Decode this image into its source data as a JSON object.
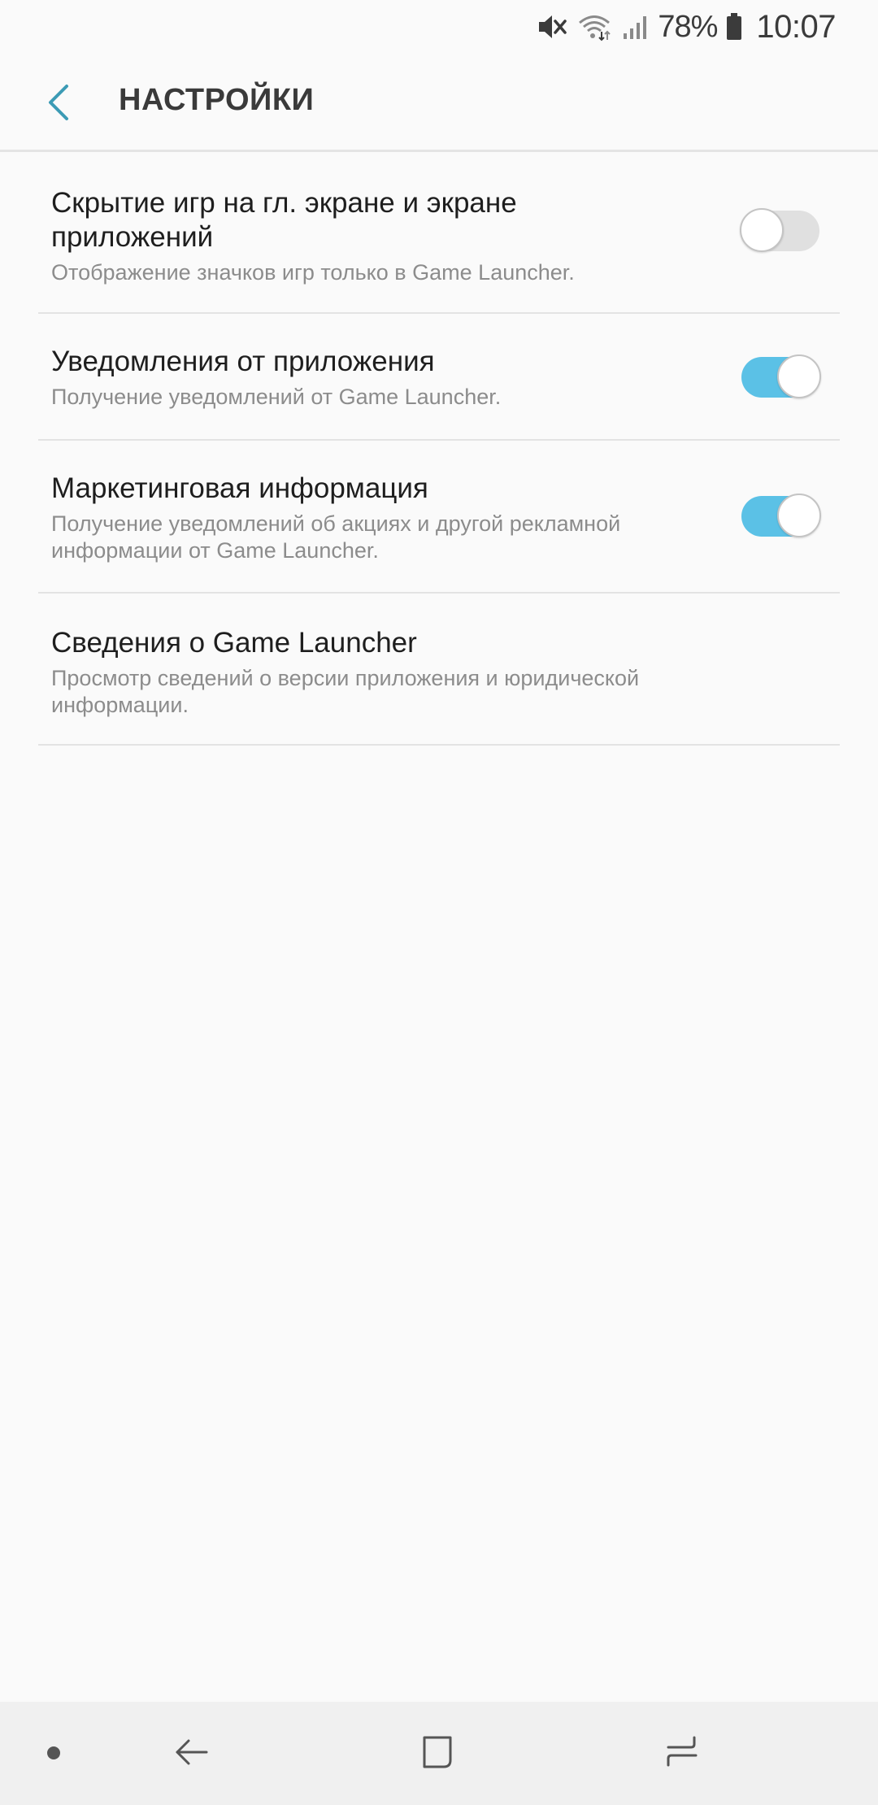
{
  "status_bar": {
    "battery_percent": "78%",
    "time": "10:07",
    "icons": [
      "mute-icon",
      "wifi-icon",
      "signal-icon",
      "battery-icon"
    ]
  },
  "header": {
    "title": "НАСТРОЙКИ",
    "back_icon": "chevron-left-icon"
  },
  "settings": [
    {
      "title": "Скрытие игр на гл. экране и экране приложений",
      "summary": "Отображение значков игр только в Game Launcher.",
      "toggle": false
    },
    {
      "title": "Уведомления от приложения",
      "summary": "Получение уведомлений от Game Launcher.",
      "toggle": true
    },
    {
      "title": "Маркетинговая информация",
      "summary": "Получение уведомлений об акциях и другой рекламной информации от Game Launcher.",
      "toggle": true
    },
    {
      "title": "Сведения о Game Launcher",
      "summary": "Просмотр сведений о версии приложения и юридической информации."
    }
  ],
  "colors": {
    "accent": "#5bc1e6",
    "back_arrow": "#3c9bb5",
    "background": "#fafafa",
    "nav_bar": "#f0f0f0"
  },
  "nav_bar": {
    "icons": [
      "nav-dot-icon",
      "back-arrow-icon",
      "home-square-icon",
      "recent-apps-icon"
    ]
  }
}
